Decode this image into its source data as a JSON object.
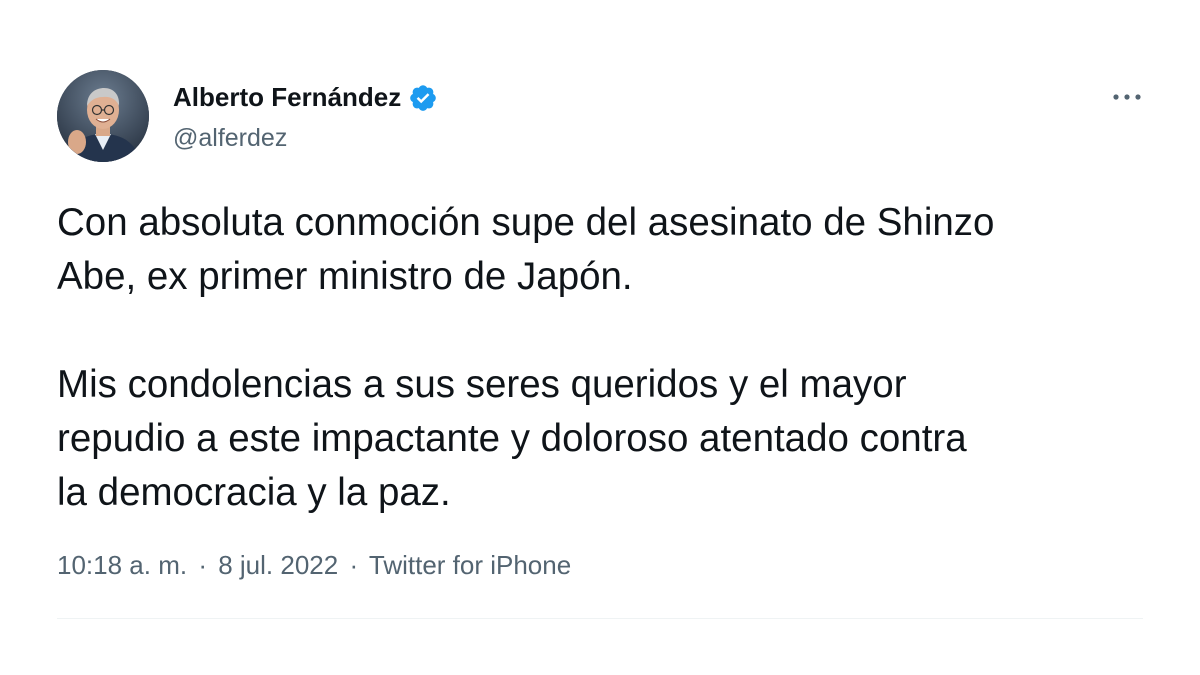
{
  "author": {
    "name": "Alberto Fernández",
    "handle": "@alferdez",
    "verified": true,
    "avatar_icon": "profile-photo"
  },
  "tweet": {
    "paragraphs": [
      "Con absoluta conmoción supe del asesinato de Shinzo\nAbe, ex primer ministro de Japón.",
      "Mis condolencias a sus seres queridos y el mayor\nrepudio a este impactante y doloroso atentado contra\nla democracia y la paz."
    ]
  },
  "meta": {
    "time": "10:18 a. m.",
    "separator": "·",
    "date": "8 jul. 2022",
    "source": "Twitter for iPhone"
  },
  "menu": {
    "more_label": "···",
    "icon": "more-horizontal-icon"
  },
  "colors": {
    "text": "#0f1419",
    "secondary": "#536471",
    "verified": "#1d9bf0",
    "divider": "#eff3f4"
  }
}
